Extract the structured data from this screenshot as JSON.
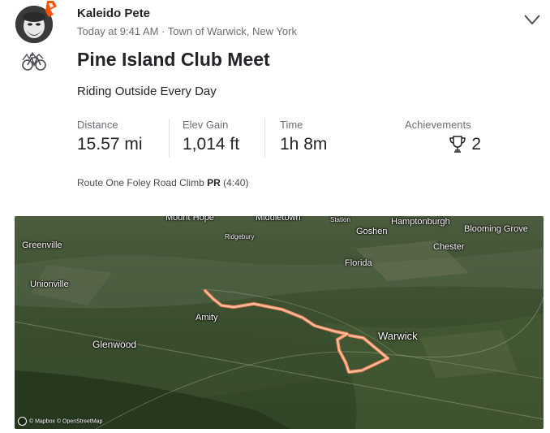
{
  "athlete": {
    "name": "Kaleido Pete",
    "meta": "Today at 9:41 AM · Town of Warwick, New York"
  },
  "activity": {
    "title": "Pine Island Club Meet",
    "description": "Riding Outside Every Day",
    "type_icon": "bike-icon"
  },
  "stats": [
    {
      "label": "Distance",
      "value": "15.57 mi"
    },
    {
      "label": "Elev Gain",
      "value": "1,014 ft"
    },
    {
      "label": "Time",
      "value": "1h 8m"
    }
  ],
  "achievements": {
    "label": "Achievements",
    "count": "2",
    "icon": "trophy-icon"
  },
  "segment": {
    "name": "Route One Foley Road Climb",
    "badge": "PR",
    "time": "(4:40)"
  },
  "map": {
    "route_color": "#fc8a5c",
    "labels": {
      "mount_hope": "Mount Hope",
      "middletown": "Middletown",
      "station": "Station",
      "hamptonburgh": "Hamptonburgh",
      "goshen": "Goshen",
      "blooming_grove": "Blooming Grove",
      "ridgebury": "Ridgebury",
      "chester": "Chester",
      "greenville": "Greenville",
      "florida": "Florida",
      "unionville": "Unionville",
      "amity": "Amity",
      "warwick": "Warwick",
      "glenwood": "Glenwood"
    },
    "attribution": "© Mapbox © OpenStreetMap"
  },
  "colors": {
    "brand": "#fc5200",
    "text": "#242428",
    "muted": "#6d6d78"
  }
}
